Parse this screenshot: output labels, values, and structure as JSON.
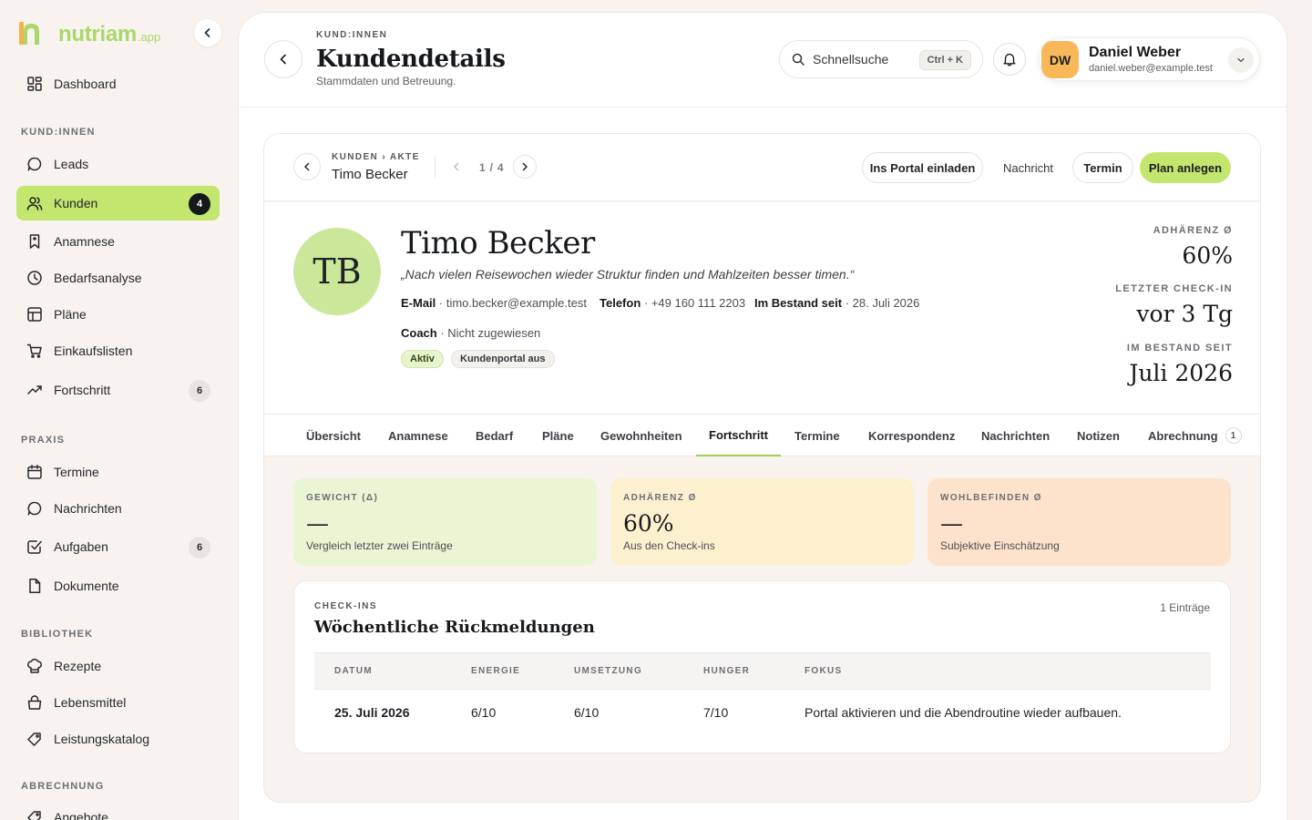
{
  "brand": {
    "name": "nutriam",
    "suffix": ".app",
    "colors": {
      "accent": "#c3e66e",
      "logo_green": "#a9d86a",
      "logo_orange": "#f6b04e"
    }
  },
  "sidebar": {
    "dashboard": {
      "label": "Dashboard",
      "icon": "grid-icon"
    },
    "sections": [
      {
        "title": "KUND:INNEN",
        "items": [
          {
            "label": "Leads",
            "icon": "chat-icon"
          },
          {
            "label": "Kunden",
            "icon": "users-icon",
            "badge": "4",
            "active": true
          },
          {
            "label": "Anamnese",
            "icon": "bookmark-icon"
          },
          {
            "label": "Bedarfsanalyse",
            "icon": "clock-icon"
          },
          {
            "label": "Pläne",
            "icon": "table-icon"
          },
          {
            "label": "Einkaufslisten",
            "icon": "cart-icon"
          },
          {
            "label": "Fortschritt",
            "icon": "trend-icon",
            "badge": "6"
          }
        ]
      },
      {
        "title": "PRAXIS",
        "items": [
          {
            "label": "Termine",
            "icon": "calendar-icon"
          },
          {
            "label": "Nachrichten",
            "icon": "chat-icon"
          },
          {
            "label": "Aufgaben",
            "icon": "check-square-icon",
            "badge": "6"
          },
          {
            "label": "Dokumente",
            "icon": "file-icon"
          }
        ]
      },
      {
        "title": "BIBLIOTHEK",
        "items": [
          {
            "label": "Rezepte",
            "icon": "chef-hat-icon"
          },
          {
            "label": "Lebensmittel",
            "icon": "basket-icon"
          },
          {
            "label": "Leistungskatalog",
            "icon": "tag-icon"
          }
        ]
      },
      {
        "title": "ABRECHNUNG",
        "items": [
          {
            "label": "Angebote",
            "icon": "tag-icon"
          }
        ]
      }
    ]
  },
  "topbar": {
    "eyebrow": "KUND:INNEN",
    "title": "Kundendetails",
    "subtitle": "Stammdaten und Betreuung.",
    "search_placeholder": "Schnellsuche",
    "shortcut": "Ctrl + K",
    "user": {
      "initials": "DW",
      "name": "Daniel Weber",
      "email": "daniel.weber@example.test"
    }
  },
  "record": {
    "crumb": "KUNDEN › AKTE",
    "name": "Timo Becker",
    "pager": "1 / 4",
    "actions": {
      "invite": "Ins Portal einladen",
      "message": "Nachricht",
      "appointment": "Termin",
      "plan": "Plan anlegen"
    }
  },
  "profile": {
    "initials": "TB",
    "name": "Timo Becker",
    "quote": "„Nach vielen Reisewochen wieder Struktur finden und Mahlzeiten besser timen.“",
    "email_label": "E-Mail",
    "email": " · timo.becker@example.test",
    "phone_label": "Telefon",
    "phone": " · +49 160 111 2203",
    "since_label": "Im Bestand seit",
    "since": " · 28. Juli 2026",
    "coach_label": "Coach",
    "coach": " · Nicht zugewiesen",
    "status_tags": [
      "Aktiv",
      "Kundenportal aus"
    ],
    "stats": [
      {
        "label": "ADHÄRENZ Ø",
        "value": "60%"
      },
      {
        "label": "LETZTER CHECK-IN",
        "value": "vor 3 Tg"
      },
      {
        "label": "IM BESTAND SEIT",
        "value": "Juli 2026"
      }
    ]
  },
  "tabs": [
    {
      "label": "Übersicht"
    },
    {
      "label": "Anamnese"
    },
    {
      "label": "Bedarf"
    },
    {
      "label": "Pläne"
    },
    {
      "label": "Gewohnheiten"
    },
    {
      "label": "Fortschritt",
      "active": true
    },
    {
      "label": "Termine"
    },
    {
      "label": "Korrespondenz"
    },
    {
      "label": "Nachrichten"
    },
    {
      "label": "Notizen"
    },
    {
      "label": "Abrechnung",
      "badge": "1"
    }
  ],
  "kpis": [
    {
      "label": "GEWICHT (Δ)",
      "value": "—",
      "sub": "Vergleich letzter zwei Einträge",
      "color": "#e9f5d3"
    },
    {
      "label": "ADHÄRENZ Ø",
      "value": "60%",
      "sub": "Aus den Check-ins",
      "color": "#fdf0cf"
    },
    {
      "label": "WOHLBEFINDEN Ø",
      "value": "—",
      "sub": "Subjektive Einschätzung",
      "color": "#fde3cc"
    }
  ],
  "checkins": {
    "eyebrow": "CHECK-INS",
    "title": "Wöchentliche Rückmeldungen",
    "count": "1 Einträge",
    "columns": [
      "DATUM",
      "ENERGIE",
      "UMSETZUNG",
      "HUNGER",
      "FOKUS"
    ],
    "rows": [
      {
        "date": "25. Juli 2026",
        "energy": "6/10",
        "execution": "6/10",
        "hunger": "7/10",
        "focus": "Portal aktivieren und die Abendroutine wieder aufbauen."
      }
    ]
  }
}
